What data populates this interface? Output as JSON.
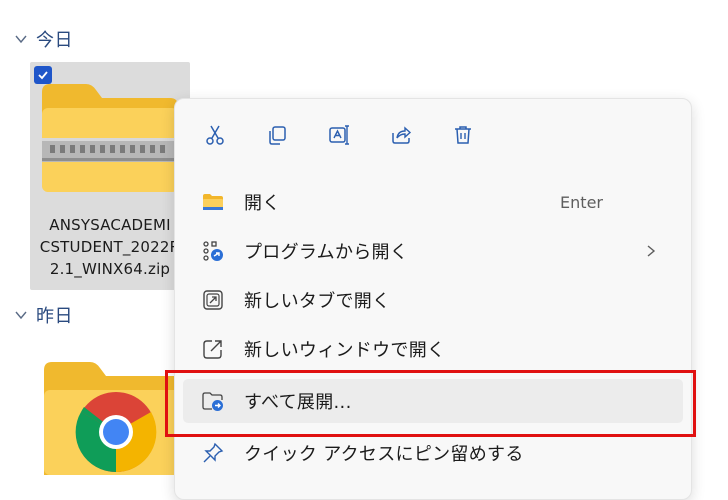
{
  "groups": {
    "today": "今日",
    "yesterday": "昨日"
  },
  "file": {
    "name": "ANSYSACADEMI\nCSTUDENT_2022R\n2.1_WINX64.zip",
    "checked": true
  },
  "toolbar": {
    "cut_icon": "scissors-icon",
    "copy_icon": "copy-icon",
    "rename_icon": "rename-icon",
    "share_icon": "share-icon",
    "delete_icon": "trash-icon"
  },
  "menu": {
    "items": [
      {
        "label": "開く",
        "shortcut": "Enter",
        "icon": "folder-icon"
      },
      {
        "label": "プログラムから開く",
        "icon": "open-with-icon",
        "submenu": true
      },
      {
        "label": "新しいタブで開く",
        "icon": "new-tab-icon"
      },
      {
        "label": "新しいウィンドウで開く",
        "icon": "new-window-icon"
      },
      {
        "label": "すべて展開...",
        "icon": "extract-icon",
        "highlighted": true
      },
      {
        "label": "クイック アクセスにピン留めする",
        "icon": "pin-icon"
      }
    ]
  },
  "colors": {
    "accent": "#1f56c9",
    "highlight_outline": "#e01010",
    "selection_bg": "#dcdcdc"
  }
}
